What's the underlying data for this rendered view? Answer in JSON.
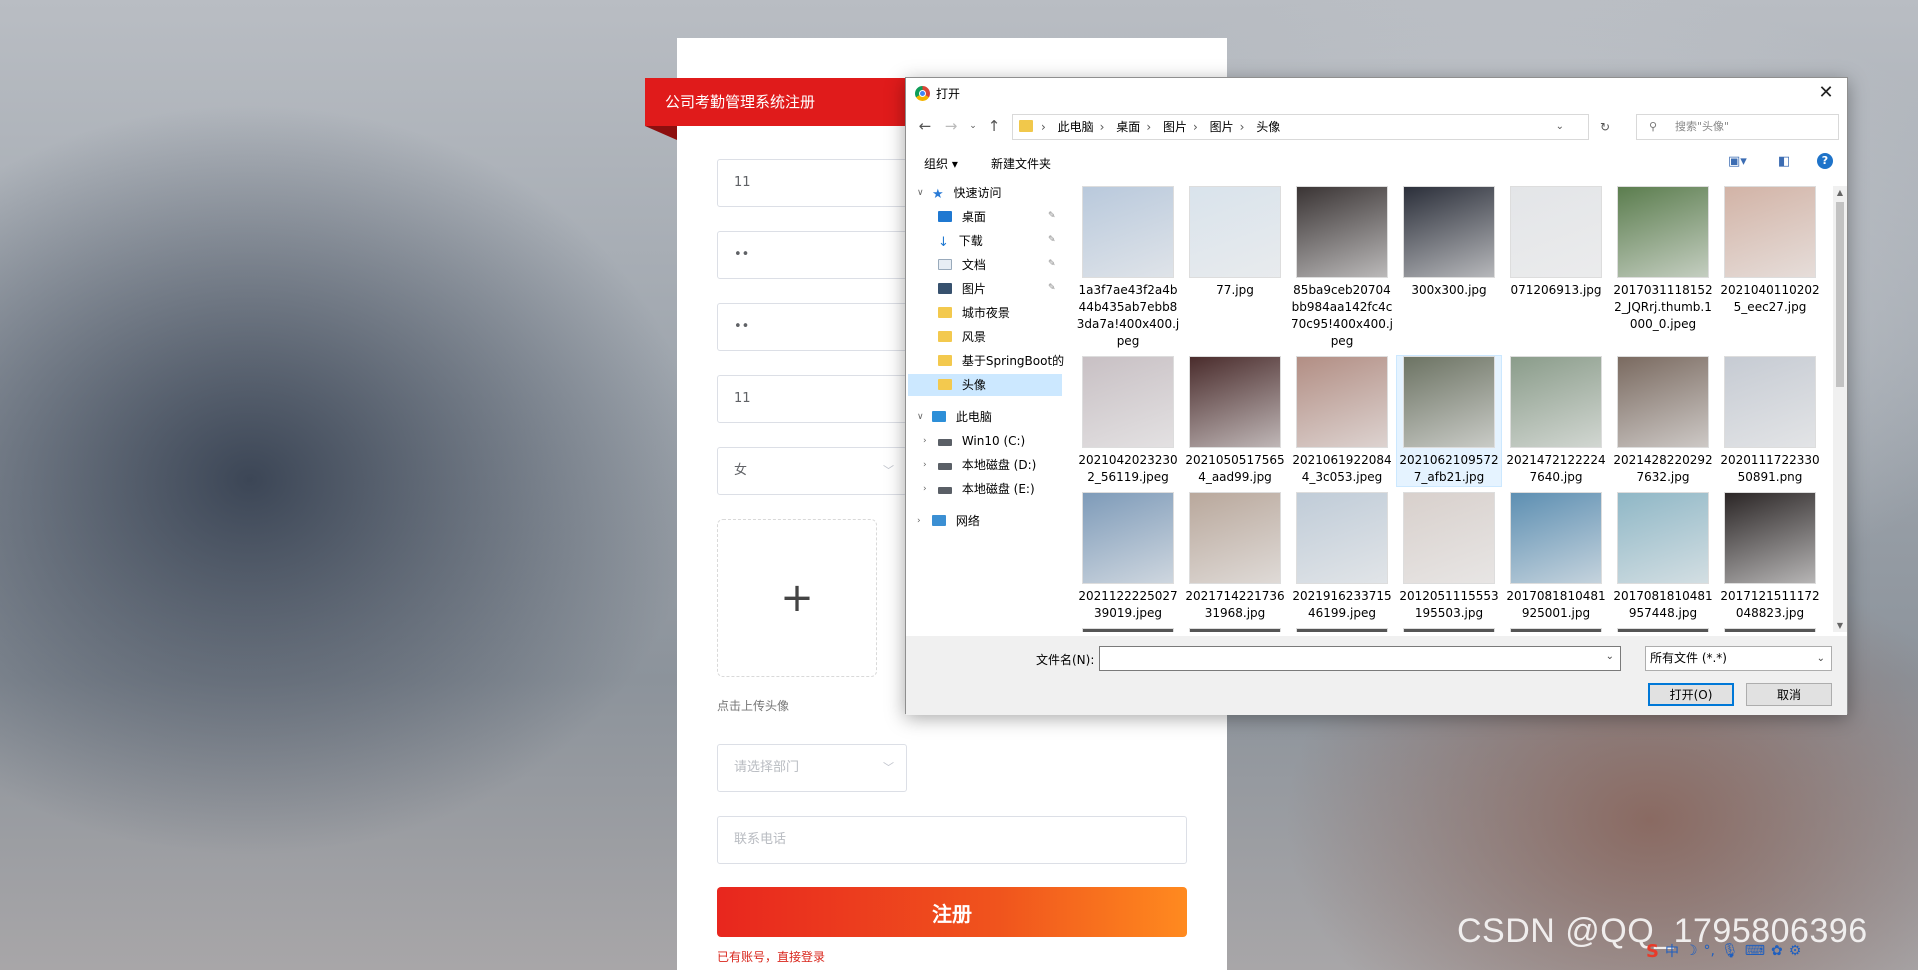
{
  "form": {
    "banner": "公司考勤管理系统注册",
    "fields": [
      {
        "value": "11",
        "placeholder": ""
      },
      {
        "value": "••",
        "placeholder": ""
      },
      {
        "value": "••",
        "placeholder": ""
      },
      {
        "value": "11",
        "placeholder": ""
      }
    ],
    "gender": "女",
    "upload_plus": "+",
    "upload_hint": "点击上传头像",
    "department_placeholder": "请选择部门",
    "phone_placeholder": "联系电话",
    "register_label": "注册",
    "login_link": "已有账号，直接登录"
  },
  "dialog": {
    "title": "打开",
    "close": "✕",
    "breadcrumbs": [
      "此电脑",
      "桌面",
      "图片",
      "图片",
      "头像"
    ],
    "search_placeholder": "搜索\"头像\"",
    "toolbar": {
      "organize": "组织 ▾",
      "new_folder": "新建文件夹",
      "help": "?"
    },
    "nav": {
      "quick_access": "快速访问",
      "desktop": "桌面",
      "downloads": "下载",
      "documents": "文档",
      "pictures": "图片",
      "night_city": "城市夜景",
      "scenery": "风景",
      "springboot": "基于SpringBoot的",
      "avatar": "头像",
      "this_pc": "此电脑",
      "drive_c": "Win10 (C:)",
      "drive_d": "本地磁盘 (D:)",
      "drive_e": "本地磁盘 (E:)",
      "network": "网络"
    },
    "files": [
      {
        "name": "1a3f7ae43f2a4b44b435ab7ebb83da7a!400x400.jpeg",
        "color": "#b9c9dc"
      },
      {
        "name": "77.jpg",
        "color": "#d9e3ec"
      },
      {
        "name": "85ba9ceb20704bb984aa142fc4c70c95!400x400.jpeg",
        "color": "#3a3434"
      },
      {
        "name": "300x300.jpg",
        "color": "#2b2f3a"
      },
      {
        "name": "071206913.jpg",
        "color": "#e3e5e8"
      },
      {
        "name": "20170311181522_JQRrj.thumb.1000_0.jpeg",
        "color": "#5b7d4e"
      },
      {
        "name": "20210401102025_eec27.jpg",
        "color": "#d2b3a6"
      },
      {
        "name": "20210420232302_56119.jpeg",
        "color": "#c8c0c4"
      },
      {
        "name": "20210505175654_aad99.jpg",
        "color": "#4a2c2c"
      },
      {
        "name": "20210619220844_3c053.jpeg",
        "color": "#b28e84"
      },
      {
        "name": "20210621095727_afb21.jpg",
        "color": "#6c7363"
      },
      {
        "name": "20214721222247640.jpg",
        "color": "#8a9c8a"
      },
      {
        "name": "20214282202927632.jpg",
        "color": "#7a6a60"
      },
      {
        "name": "2020111722330 50891.png",
        "color": "#c6cbd3"
      },
      {
        "name": "2021122225027 39019.jpeg",
        "color": "#7e9bb9"
      },
      {
        "name": "2021714221736 31968.jpg",
        "color": "#b9a89c"
      },
      {
        "name": "2021916233715 46199.jpeg",
        "color": "#c0ccd8"
      },
      {
        "name": "2012051115553 195503.jpg",
        "color": "#d8d0cc"
      },
      {
        "name": "2017081810481 925001.jpg",
        "color": "#5d8fb2"
      },
      {
        "name": "2017081810481 957448.jpg",
        "color": "#8fb7c6"
      },
      {
        "name": "2017121511172 048823.jpg",
        "color": "#2b2626"
      }
    ],
    "filename_label": "文件名(N):",
    "filename_value": "",
    "filter": "所有文件 (*.*)",
    "open_button": "打开(O)",
    "cancel_button": "取消"
  },
  "watermark": "CSDN @QQ_1795806396"
}
